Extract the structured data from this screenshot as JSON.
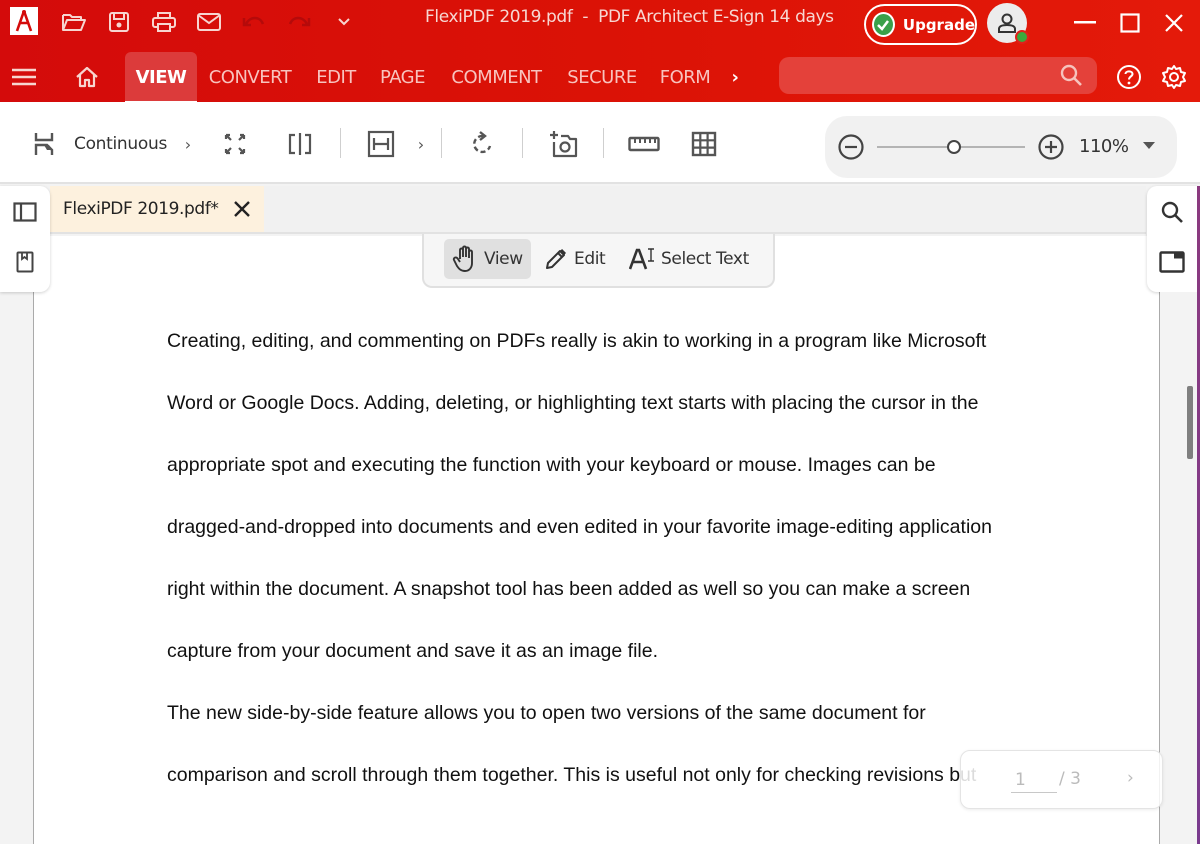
{
  "window": {
    "title_file": "FlexiPDF 2019.pdf",
    "title_separator": "-",
    "title_app": "PDF Architect E-Sign 14 days",
    "upgrade_label": "Upgrade",
    "quick_access": [
      "open-folder",
      "save",
      "print",
      "email",
      "undo",
      "redo",
      "customize"
    ]
  },
  "nav": {
    "tabs": [
      {
        "label": "VIEW",
        "active": true
      },
      {
        "label": "CONVERT"
      },
      {
        "label": "EDIT"
      },
      {
        "label": "PAGE"
      },
      {
        "label": "COMMENT"
      },
      {
        "label": "SECURE"
      },
      {
        "label": "FORM"
      }
    ],
    "more": "›",
    "search_placeholder": ""
  },
  "toolbar": {
    "page_layout_label": "Continuous",
    "chevron": "›",
    "zoom_value": "110%",
    "zoom_slider_fraction": 0.52
  },
  "document": {
    "tab_label": "FlexiPDF 2019.pdf*",
    "modes": [
      {
        "label": "View",
        "active": true
      },
      {
        "label": "Edit"
      },
      {
        "label": "Select Text"
      }
    ],
    "lines": [
      "Creating, editing, and commenting on PDFs really is akin to working in a program like Microsoft",
      "Word or Google Docs. Adding, deleting, or highlighting text starts with placing the cursor in the",
      "appropriate spot and executing the function with your keyboard or mouse. Images can be",
      "dragged-and-dropped into documents and even edited in your favorite image-editing application",
      "right within the document. A snapshot tool has been added as well so you can make a screen",
      "capture from your document and save it as an image file.",
      "The new side-by-side feature allows you to open two versions of the same document for",
      "comparison and scroll through them together. This is useful not only for checking revisions but"
    ]
  },
  "pager": {
    "current": "1",
    "total": "/ 3",
    "next": "›"
  },
  "colors": {
    "brand_red": "#d40b0b",
    "active_tab": "#dc3b3b",
    "doc_tab_bg": "#fdf1de"
  }
}
